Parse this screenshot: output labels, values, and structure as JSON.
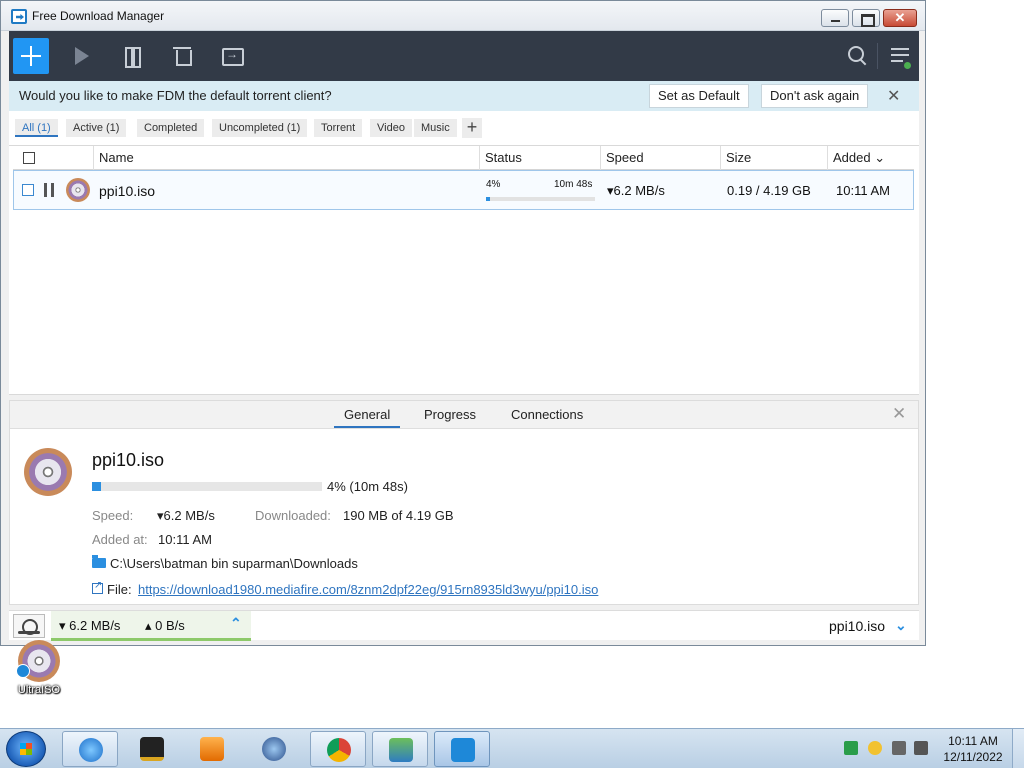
{
  "window": {
    "title": "Free Download Manager",
    "close_label": "✕"
  },
  "notification": {
    "message": "Would you like to make FDM the default torrent client?",
    "set_default": "Set as Default",
    "dont_ask": "Don't ask again",
    "close": "✕"
  },
  "filters": [
    "All (1)",
    "Active (1)",
    "Completed",
    "Uncompleted (1)",
    "Torrent",
    "Video",
    "Music"
  ],
  "filter_add": "+",
  "columns": {
    "name": "Name",
    "status": "Status",
    "speed": "Speed",
    "size": "Size",
    "added": "Added ⌄"
  },
  "downloads": [
    {
      "name": "ppi10.iso",
      "percent_label": "4%",
      "progress": 0.04,
      "eta": "10m 48s",
      "speed": "▾6.2 MB/s",
      "size": "0.19 / 4.19 GB",
      "added": "10:11 AM"
    }
  ],
  "details": {
    "tabs": [
      "General",
      "Progress",
      "Connections"
    ],
    "close": "✕",
    "name": "ppi10.iso",
    "progress": 0.04,
    "progress_label": "4% (10m 48s)",
    "speed_label": "Speed:",
    "speed_value": "▾6.2 MB/s",
    "downloaded_label": "Downloaded:",
    "downloaded_value": "190 MB of 4.19 GB",
    "added_label": "Added at:",
    "added_value": "10:11 AM",
    "folder": "C:\\Users\\batman bin suparman\\Downloads",
    "file_label": "File:",
    "file_url": "https://download1980.mediafire.com/8znm2dpf22eg/915rn8935ld3wyu/ppi10.iso"
  },
  "statusbar": {
    "down": "▾ 6.2 MB/s",
    "up": "▴ 0 B/s",
    "chevron": "⌃",
    "current_file": "ppi10.iso",
    "file_chevron": "⌄"
  },
  "desktop": {
    "icon_label": "UltraISO"
  },
  "taskbar": {
    "time": "10:11 AM",
    "date": "12/11/2022"
  },
  "colors": {
    "accent": "#2196f3",
    "toolbar": "#323a47",
    "notification_bg": "#d9ecf4",
    "progress": "#2b8fe0"
  }
}
